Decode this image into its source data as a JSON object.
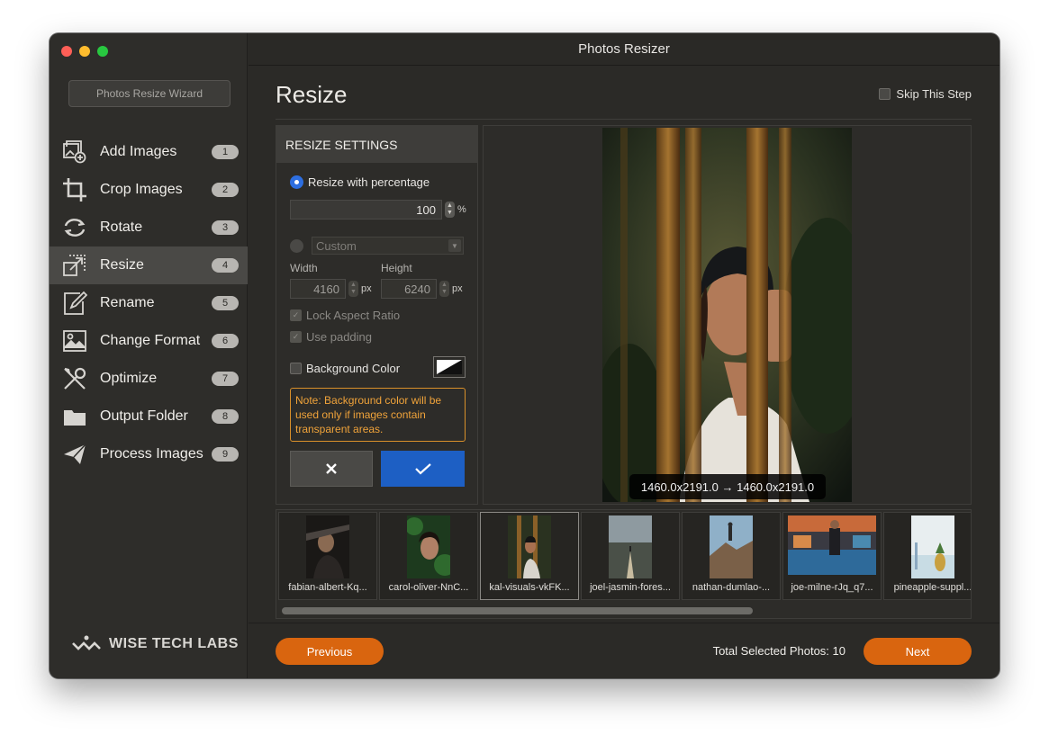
{
  "window": {
    "title": "Photos Resizer"
  },
  "sidebar": {
    "wizard_button": "Photos Resize Wizard",
    "items": [
      {
        "label": "Add Images",
        "badge": "1",
        "icon": "add-images-icon"
      },
      {
        "label": "Crop Images",
        "badge": "2",
        "icon": "crop-icon"
      },
      {
        "label": "Rotate",
        "badge": "3",
        "icon": "rotate-icon"
      },
      {
        "label": "Resize",
        "badge": "4",
        "icon": "resize-icon",
        "active": true
      },
      {
        "label": "Rename",
        "badge": "5",
        "icon": "rename-icon"
      },
      {
        "label": "Change Format",
        "badge": "6",
        "icon": "change-format-icon"
      },
      {
        "label": "Optimize",
        "badge": "7",
        "icon": "optimize-icon"
      },
      {
        "label": "Output Folder",
        "badge": "8",
        "icon": "folder-icon"
      },
      {
        "label": "Process Images",
        "badge": "9",
        "icon": "send-icon"
      }
    ],
    "brand": "WISE TECH LABS"
  },
  "main": {
    "title": "Resize",
    "skip_label": "Skip This Step"
  },
  "settings": {
    "header": "RESIZE SETTINGS",
    "percentage_label": "Resize with percentage",
    "percentage_value": "100",
    "percent_unit": "%",
    "custom_label": "Custom",
    "width_label": "Width",
    "height_label": "Height",
    "width_value": "4160",
    "height_value": "6240",
    "px_unit": "px",
    "lock_aspect_label": "Lock Aspect Ratio",
    "use_padding_label": "Use padding",
    "background_color_label": "Background Color",
    "note": "Note: Background color will be used only if images contain transparent areas."
  },
  "preview": {
    "dimensions": "1460.0x2191.0 → 1460.0x2191.0"
  },
  "thumbnails": [
    {
      "name": "fabian-albert-Kq..."
    },
    {
      "name": "carol-oliver-NnC..."
    },
    {
      "name": "kal-visuals-vkFK...",
      "selected": true
    },
    {
      "name": "joel-jasmin-fores..."
    },
    {
      "name": "nathan-dumlao-..."
    },
    {
      "name": "joe-milne-rJq_q7..."
    },
    {
      "name": "pineapple-suppl..."
    }
  ],
  "footer": {
    "previous_label": "Previous",
    "next_label": "Next",
    "total_label": "Total Selected Photos: 10"
  },
  "colors": {
    "accent_orange": "#d9650f",
    "accent_blue": "#1d5fc4",
    "note_orange": "#f0a33a"
  }
}
